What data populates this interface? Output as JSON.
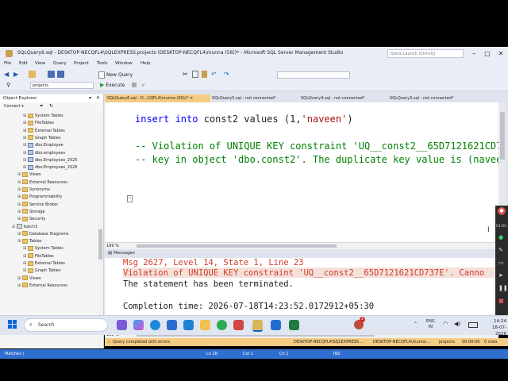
{
  "window": {
    "title": "SQLQuery6.sql - DESKTOP-NECQFL4\\SQLEXPRESS.projects (DESKTOP-NECQFL4\\munna (56))* - Microsoft SQL Server Management Studio",
    "quick_launch_placeholder": "Quick Launch (Ctrl+Q)"
  },
  "menu": [
    "File",
    "Edit",
    "View",
    "Query",
    "Project",
    "Tools",
    "Window",
    "Help"
  ],
  "toolbar": {
    "new_query_label": "New Query",
    "database_select": "projects",
    "execute_label": "Execute"
  },
  "object_explorer": {
    "title": "Object Explorer",
    "connect_label": "Connect ▾",
    "tree": [
      {
        "label": "System Tables",
        "depth": 3,
        "type": "folder"
      },
      {
        "label": "FileTables",
        "depth": 3,
        "type": "folder"
      },
      {
        "label": "External Tables",
        "depth": 3,
        "type": "folder"
      },
      {
        "label": "Graph Tables",
        "depth": 3,
        "type": "folder"
      },
      {
        "label": "dbo.Employee",
        "depth": 3,
        "type": "table"
      },
      {
        "label": "dbo.employees",
        "depth": 3,
        "type": "table"
      },
      {
        "label": "dbo.Employees_2025",
        "depth": 3,
        "type": "table"
      },
      {
        "label": "dbo.Employees_2026",
        "depth": 3,
        "type": "table"
      },
      {
        "label": "Views",
        "depth": 2,
        "type": "folder"
      },
      {
        "label": "External Resources",
        "depth": 2,
        "type": "folder"
      },
      {
        "label": "Synonyms",
        "depth": 2,
        "type": "folder"
      },
      {
        "label": "Programmability",
        "depth": 2,
        "type": "folder"
      },
      {
        "label": "Service Broker",
        "depth": 2,
        "type": "folder"
      },
      {
        "label": "Storage",
        "depth": 2,
        "type": "folder"
      },
      {
        "label": "Security",
        "depth": 2,
        "type": "folder"
      },
      {
        "label": "batch3",
        "depth": 1,
        "type": "db"
      },
      {
        "label": "Database Diagrams",
        "depth": 2,
        "type": "folder"
      },
      {
        "label": "Tables",
        "depth": 2,
        "type": "folder"
      },
      {
        "label": "System Tables",
        "depth": 3,
        "type": "folder"
      },
      {
        "label": "FileTables",
        "depth": 3,
        "type": "folder"
      },
      {
        "label": "External Tables",
        "depth": 3,
        "type": "folder"
      },
      {
        "label": "Graph Tables",
        "depth": 3,
        "type": "folder"
      },
      {
        "label": "Views",
        "depth": 2,
        "type": "folder"
      },
      {
        "label": "External Resources",
        "depth": 2,
        "type": "folder"
      }
    ]
  },
  "tabs": [
    {
      "label": "SQLQuery6.sql - D...CQFL4\\munna (56))*",
      "active": true
    },
    {
      "label": "SQLQuery5.sql - not connected*",
      "active": false
    },
    {
      "label": "SQLQuery4.sql - not connected*",
      "active": false
    },
    {
      "label": "SQLQuery3.sql - not connected*",
      "active": false
    }
  ],
  "editor": {
    "line1_kw1": "insert into",
    "line1_txt": " const2 values (1,",
    "line1_str": "'naveen'",
    "line1_end": ")",
    "comment1": "-- Violation of UNIQUE KEY constraint 'UQ__const2__65D7121621CD7",
    "comment2": "-- key in object 'dbo.const2'. The duplicate key value is (navee",
    "zoom": "199 %"
  },
  "results": {
    "tab_label": "Messages",
    "msg_header": "Msg 2627, Level 14, State 1, Line 23",
    "msg_error": "Violation of UNIQUE KEY constraint 'UQ__const2__65D7121621CD737E'. Canno",
    "msg_terminated": "The statement has been terminated.",
    "msg_completion": "Completion time: 2026-07-18T14:23:52.0172912+05:30",
    "zoom": "199 %"
  },
  "query_status": {
    "text": "Query completed with errors.",
    "server": "DESKTOP-NECQFL4\\SQLEXPRESS ...",
    "user": "DESKTOP-NECQFL4\\munna ...",
    "db": "projects",
    "time": "00:00:00",
    "rows": "0 rows"
  },
  "statusbar": {
    "matches": "Matches (",
    "line": "Ln 28",
    "col": "Col 1",
    "ch": "Ch 1",
    "mode": "INS"
  },
  "taskbar": {
    "search_placeholder": "Search",
    "language": "ENG",
    "region": "IN",
    "time": "14:24",
    "date": "18-07-2026",
    "badge": "2"
  },
  "side_strip": {
    "time_label": "01:05"
  },
  "colors": {
    "accent_tab": "#f5cc84",
    "statusbar": "#2f6fd0",
    "keyword": "#0000ff",
    "string": "#a31515",
    "comment": "#008000",
    "error": "#d33a2c"
  }
}
